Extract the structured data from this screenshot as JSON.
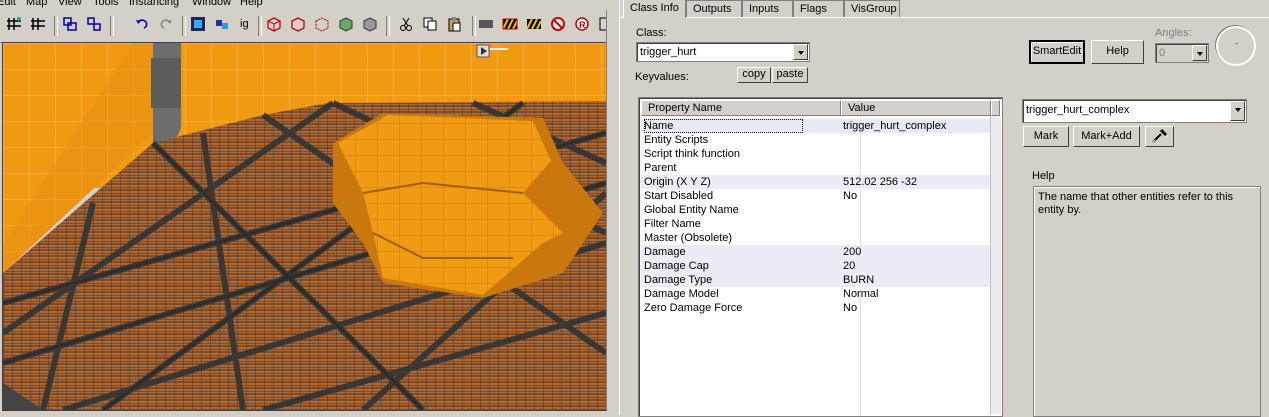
{
  "menubar": {
    "items": [
      "Edit",
      "Map",
      "View",
      "Tools",
      "Instancing",
      "Window",
      "Help"
    ]
  },
  "toolbar": {
    "ig_label": "ig"
  },
  "tabs": [
    {
      "label": "Class Info",
      "active": true
    },
    {
      "label": "Outputs",
      "active": false
    },
    {
      "label": "Inputs",
      "active": false
    },
    {
      "label": "Flags",
      "active": false
    },
    {
      "label": "VisGroup",
      "active": false
    }
  ],
  "class_info": {
    "class_label": "Class:",
    "class_value": "trigger_hurt",
    "keyvalues_label": "Keyvalues:",
    "copy_label": "copy",
    "paste_label": "paste",
    "smartedit_label": "SmartEdit",
    "help_button_label": "Help",
    "angles_label": "Angles:",
    "angles_value": "0"
  },
  "properties": {
    "col_name": "Property Name",
    "col_value": "Value",
    "rows": [
      {
        "name": "Name",
        "value": "trigger_hurt_complex"
      },
      {
        "name": "Entity Scripts",
        "value": ""
      },
      {
        "name": "Script think function",
        "value": ""
      },
      {
        "name": "Parent",
        "value": ""
      },
      {
        "name": "Origin (X Y Z)",
        "value": "512.02 256 -32"
      },
      {
        "name": "Start Disabled",
        "value": "No"
      },
      {
        "name": "Global Entity Name",
        "value": ""
      },
      {
        "name": "Filter Name",
        "value": ""
      },
      {
        "name": "Master (Obsolete)",
        "value": ""
      },
      {
        "name": "Damage",
        "value": "200"
      },
      {
        "name": "Damage Cap",
        "value": "20"
      },
      {
        "name": "Damage Type",
        "value": "BURN"
      },
      {
        "name": "Damage Model",
        "value": "Normal"
      },
      {
        "name": "Zero Damage Force",
        "value": "No"
      }
    ]
  },
  "value_editor": {
    "value": "trigger_hurt_complex",
    "mark_label": "Mark",
    "mark_add_label": "Mark+Add",
    "help_heading": "Help",
    "help_text": "The name that other entities refer to this entity by."
  },
  "colors": {
    "panel_bg": "#d4d0c8",
    "floor_orange": "#f09a10",
    "grid_dark": "#3a3a3a",
    "selection_tint": "#e9e9f4"
  }
}
